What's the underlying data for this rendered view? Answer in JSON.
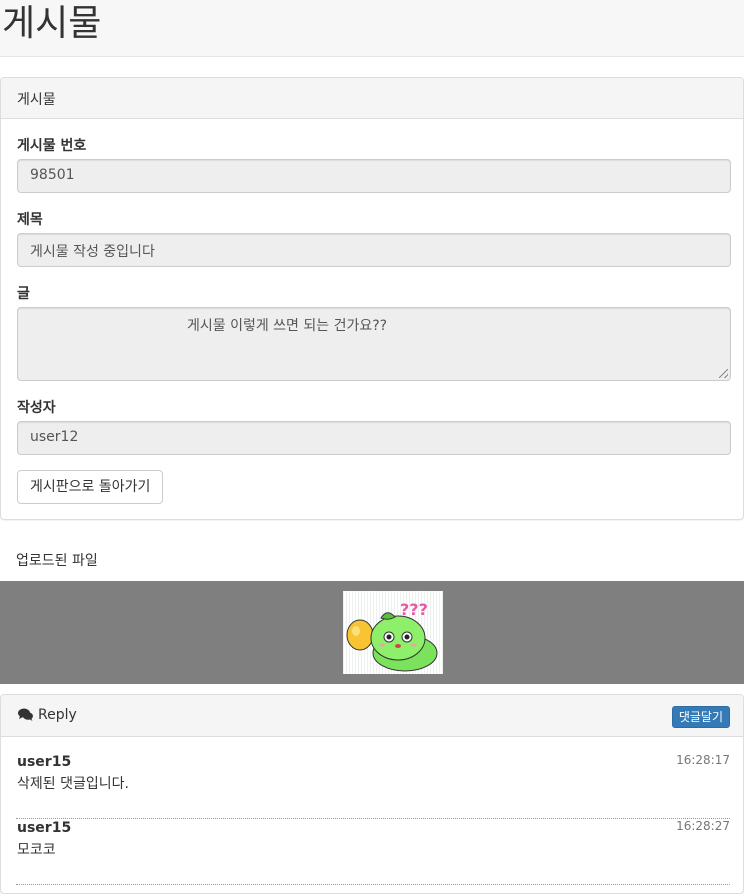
{
  "page": {
    "title": "게시물"
  },
  "post_panel": {
    "heading": "게시물",
    "fields": {
      "number_label": "게시물 번호",
      "number_value": "98501",
      "title_label": "제목",
      "title_value": "게시물 작성 중입니다",
      "content_label": "글",
      "content_value": "게시물 이렇게 쓰면 되는 건가요??",
      "author_label": "작성자",
      "author_value": "user12"
    },
    "back_button": "게시판으로 돌아가기"
  },
  "uploads": {
    "title": "업로드된 파일",
    "image_icon": "cartoon-character-icon",
    "image_text": "???"
  },
  "reply_panel": {
    "heading": "Reply",
    "heading_icon": "comments-icon",
    "add_button": "댓글달기",
    "items": [
      {
        "user": "user15",
        "time": "16:28:17",
        "text": "삭제된 댓글입니다."
      },
      {
        "user": "user15",
        "time": "16:28:27",
        "text": "모코코"
      }
    ]
  },
  "colors": {
    "primary": "#337ab7",
    "input_bg": "#eeeeee",
    "panel_heading_bg": "#f5f5f5",
    "upload_strip_bg": "#7f7f7f"
  }
}
